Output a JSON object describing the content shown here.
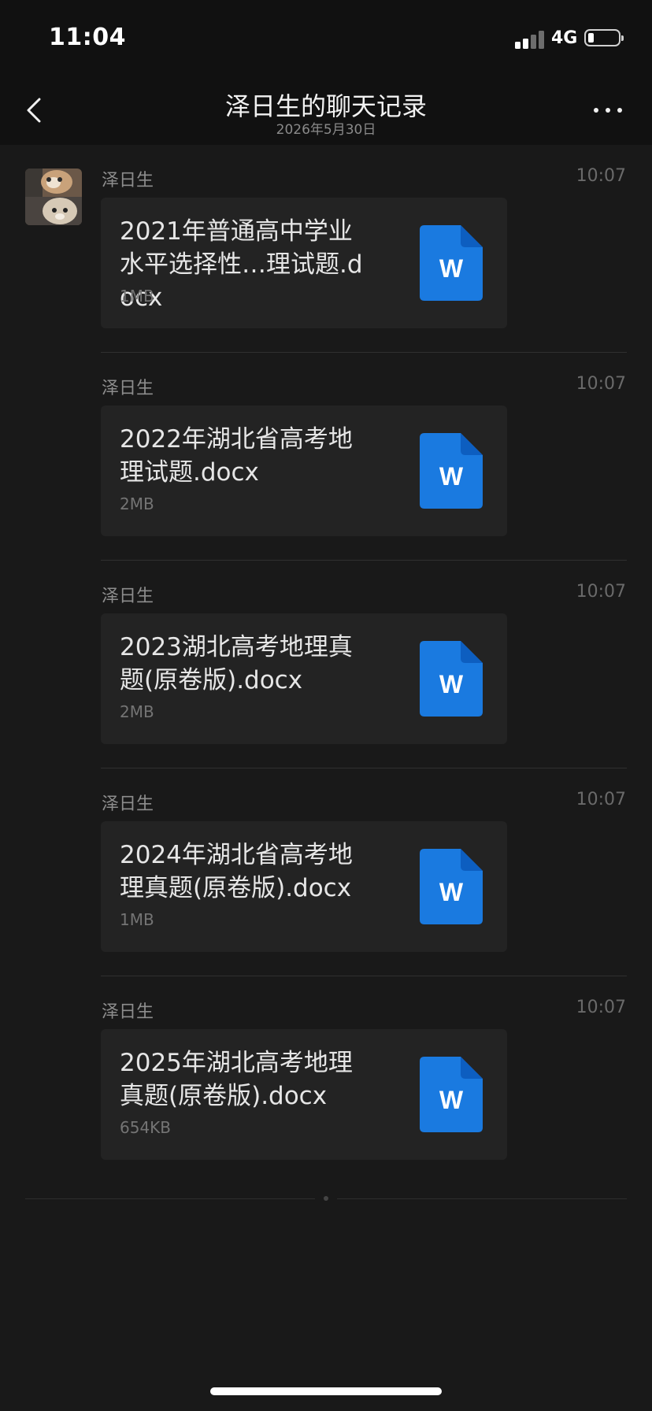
{
  "status_bar": {
    "time": "11:04",
    "network": "4G",
    "battery_level": 0.15
  },
  "nav": {
    "title": "泽日生的聊天记录",
    "subtitle": "2026年5月30日",
    "back_icon": "chevron-left-icon",
    "more_icon": "more-dots-icon"
  },
  "messages": [
    {
      "sender": "泽日生",
      "time": "10:07",
      "file_name": "2021年普通高中学业水平选择性…理试题.docx",
      "file_size": "1MB",
      "file_icon": "word-doc-icon"
    },
    {
      "sender": "泽日生",
      "time": "10:07",
      "file_name": "2022年湖北省高考地理试题.docx",
      "file_size": "2MB",
      "file_icon": "word-doc-icon"
    },
    {
      "sender": "泽日生",
      "time": "10:07",
      "file_name": "2023湖北高考地理真题(原卷版).docx",
      "file_size": "2MB",
      "file_icon": "word-doc-icon"
    },
    {
      "sender": "泽日生",
      "time": "10:07",
      "file_name": "2024年湖北省高考地理真题(原卷版).docx",
      "file_size": "1MB",
      "file_icon": "word-doc-icon"
    },
    {
      "sender": "泽日生",
      "time": "10:07",
      "file_name": "2025年湖北高考地理真题(原卷版).docx",
      "file_size": "654KB",
      "file_icon": "word-doc-icon"
    }
  ],
  "colors": {
    "background": "#191919",
    "header": "#111111",
    "card": "#232323",
    "word_blue": "#1a7ae0"
  }
}
